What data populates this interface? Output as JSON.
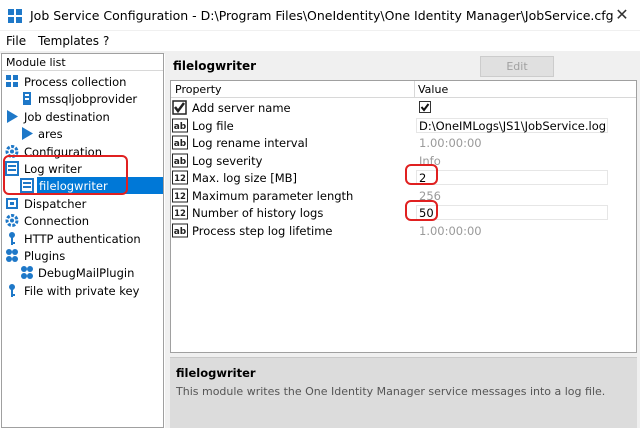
{
  "window": {
    "title": "Job Service Configuration - D:\\Program Files\\OneIdentity\\One Identity Manager\\JobService.cfg"
  },
  "menu": {
    "items": [
      "File",
      "Templates",
      "?"
    ]
  },
  "module_list": {
    "header": "Module list",
    "items": [
      {
        "label": "Process collection",
        "icon": "process-collection-icon"
      },
      {
        "label": "mssqljobprovider",
        "icon": "provider-icon"
      },
      {
        "label": "Job destination",
        "icon": "play-arrow-icon"
      },
      {
        "label": "ares",
        "icon": "play-arrow-icon"
      },
      {
        "label": "Configuration",
        "icon": "gear-icon"
      },
      {
        "label": "Log writer",
        "icon": "log-writer-icon"
      },
      {
        "label": "filelogwriter",
        "icon": "log-writer-icon"
      },
      {
        "label": "Dispatcher",
        "icon": "dispatcher-icon"
      },
      {
        "label": "Connection",
        "icon": "gear-icon"
      },
      {
        "label": "HTTP authentication",
        "icon": "key-icon"
      },
      {
        "label": "Plugins",
        "icon": "plugin-icon"
      },
      {
        "label": "DebugMailPlugin",
        "icon": "plugin-icon"
      },
      {
        "label": "File with private key",
        "icon": "key-icon"
      }
    ],
    "selected": "filelogwriter"
  },
  "module": {
    "title": "filelogwriter",
    "edit_label": "Edit",
    "columns": {
      "property": "Property",
      "value": "Value"
    },
    "properties": [
      {
        "name": "Add server name",
        "type": "checkbox",
        "value": "checked",
        "disabled": false
      },
      {
        "name": "Log file",
        "type": "text",
        "value": "D:\\OneIMLogs\\JS1\\JobService.log",
        "disabled": false
      },
      {
        "name": "Log rename interval",
        "type": "text",
        "value": "1.00:00:00",
        "disabled": true
      },
      {
        "name": "Log severity",
        "type": "text",
        "value": "Info",
        "disabled": true
      },
      {
        "name": "Max. log size [MB]",
        "type": "number",
        "value": "2",
        "disabled": false
      },
      {
        "name": "Maximum parameter length",
        "type": "number",
        "value": "256",
        "disabled": true
      },
      {
        "name": "Number of history logs",
        "type": "number",
        "value": "50",
        "disabled": false
      },
      {
        "name": "Process step log lifetime",
        "type": "text",
        "value": "1.00:00:00",
        "disabled": true
      }
    ],
    "description_title": "filelogwriter",
    "description": "This module writes the One Identity Manager service messages into a log file."
  },
  "colors": {
    "selection": "#0078d7",
    "highlight": "#e02020",
    "icon_blue": "#1e78c8"
  }
}
